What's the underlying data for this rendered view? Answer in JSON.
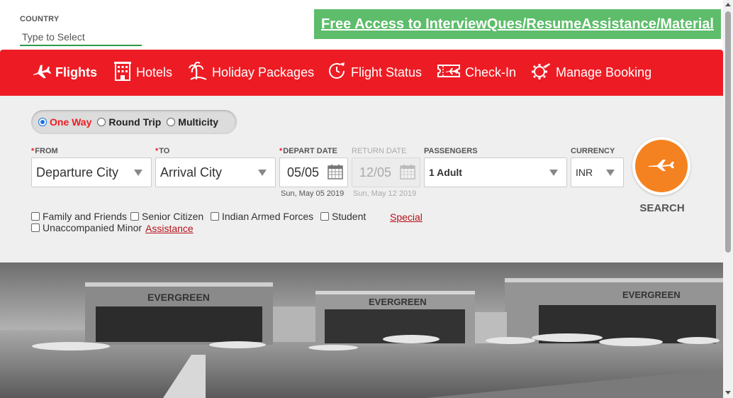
{
  "country": {
    "label": "COUNTRY",
    "placeholder": "Type to Select"
  },
  "promo": {
    "text": "Free Access to InterviewQues/ResumeAssistance/Material"
  },
  "nav": {
    "items": [
      {
        "label": "Flights",
        "icon": "plane-icon",
        "active": true
      },
      {
        "label": "Hotels",
        "icon": "hotel-icon"
      },
      {
        "label": "Holiday Packages",
        "icon": "palm-tree-icon"
      },
      {
        "label": "Flight Status",
        "icon": "clock-plane-icon"
      },
      {
        "label": "Check-In",
        "icon": "ticket-plane-icon"
      },
      {
        "label": "Manage Booking",
        "icon": "gear-plane-icon"
      }
    ]
  },
  "trip_type": {
    "options": [
      "One Way",
      "Round Trip",
      "Multicity"
    ],
    "selected": "One Way"
  },
  "fields": {
    "from": {
      "label": "FROM",
      "value": "Departure City"
    },
    "to": {
      "label": "TO",
      "value": "Arrival City"
    },
    "depart": {
      "label": "DEPART DATE",
      "value": "05/05",
      "sub": "Sun, May 05 2019"
    },
    "return": {
      "label": "RETURN DATE",
      "value": "12/05",
      "sub": "Sun, May 12 2019"
    },
    "passengers": {
      "label": "PASSENGERS",
      "value": "1 Adult"
    },
    "currency": {
      "label": "CURRENCY",
      "value": "INR"
    }
  },
  "search": {
    "label": "SEARCH"
  },
  "checkboxes": [
    "Family and Friends",
    "Senior Citizen",
    "Indian Armed Forces",
    "Student",
    "Unaccompanied Minor"
  ],
  "special": {
    "part1": "Special",
    "part2": "Assistance"
  },
  "hero": {
    "sign": "EVERGREEN"
  },
  "colors": {
    "brand_red": "#ed1c24",
    "promo_green": "#5dbd6a",
    "search_orange": "#f58220"
  }
}
